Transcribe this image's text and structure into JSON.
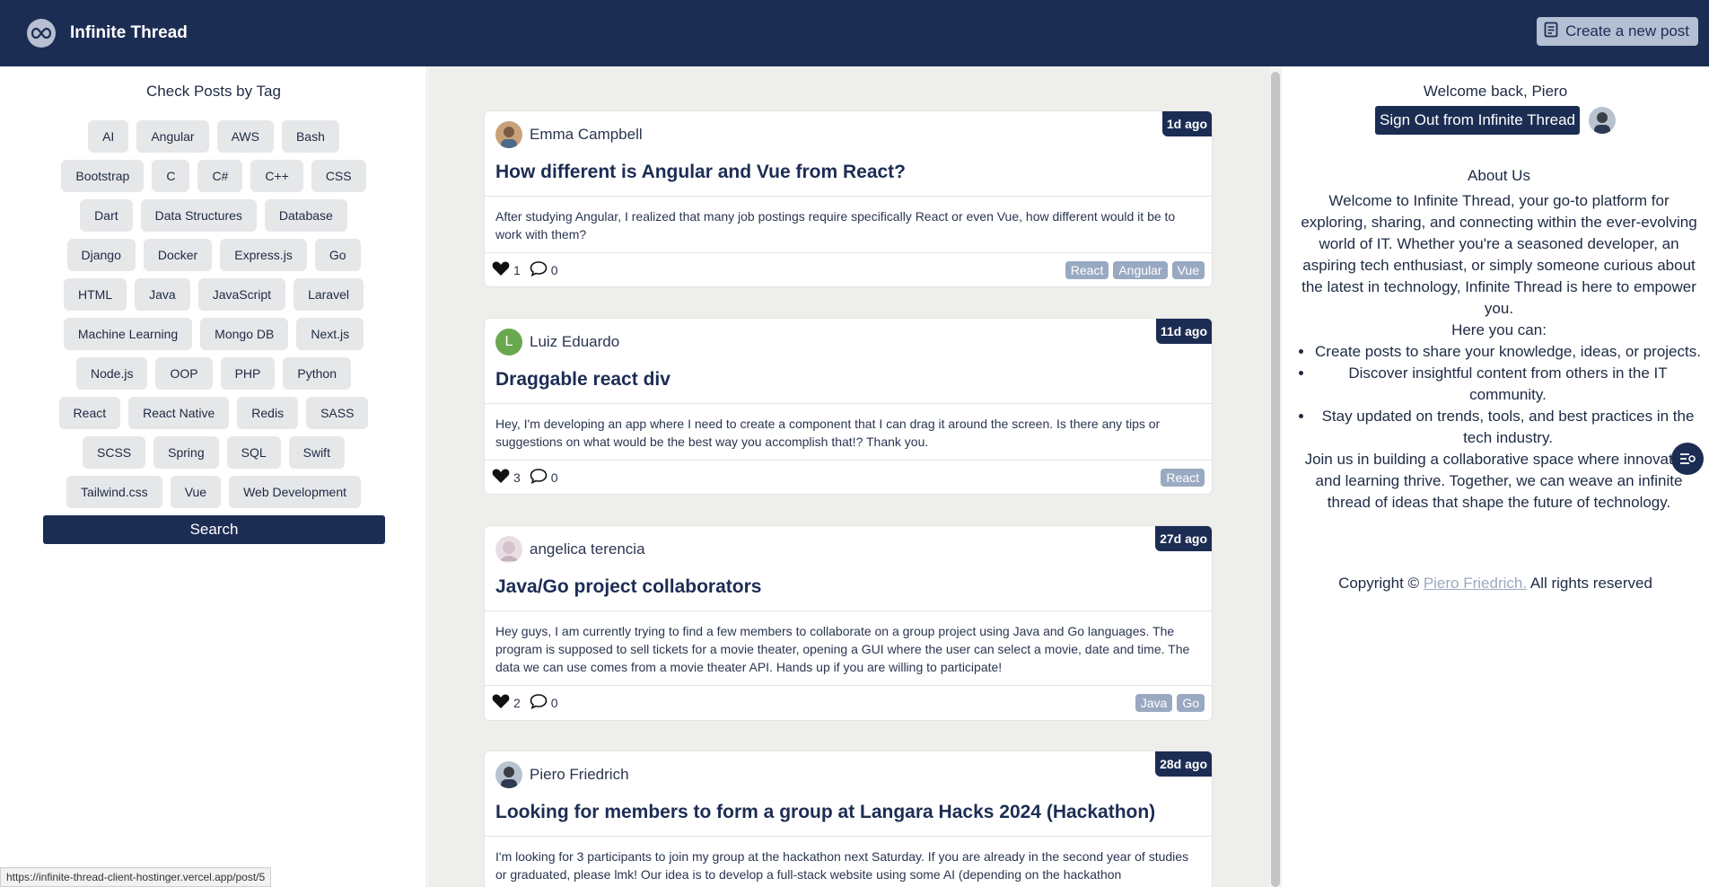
{
  "header": {
    "brand": "Infinite Thread",
    "create_label": "Create a new post"
  },
  "left": {
    "title": "Check Posts by Tag",
    "tags": [
      "AI",
      "Angular",
      "AWS",
      "Bash",
      "Bootstrap",
      "C",
      "C#",
      "C++",
      "CSS",
      "Dart",
      "Data Structures",
      "Database",
      "Django",
      "Docker",
      "Express.js",
      "Go",
      "HTML",
      "Java",
      "JavaScript",
      "Laravel",
      "Machine Learning",
      "Mongo DB",
      "Next.js",
      "Node.js",
      "OOP",
      "PHP",
      "Python",
      "React",
      "React Native",
      "Redis",
      "SASS",
      "SCSS",
      "Spring",
      "SQL",
      "Swift",
      "Tailwind.css",
      "Vue",
      "Web Development"
    ],
    "search_label": "Search"
  },
  "status_url": "https://infinite-thread-client-hostinger.vercel.app/post/5",
  "posts": [
    {
      "author": "Emma Campbell",
      "age": "1d ago",
      "title": "How different is Angular and Vue from React?",
      "body": "After studying Angular, I realized that many job postings require specifically React or even Vue, how different would it be to work with them?",
      "likes": "1",
      "comments": "0",
      "tags": [
        "React",
        "Angular",
        "Vue"
      ]
    },
    {
      "author": "Luiz Eduardo",
      "avatar_letter": "L",
      "age": "11d ago",
      "title": "Draggable react div",
      "body": "Hey, I'm developing an app where I need to create a component that I can drag it around the screen. Is there any tips or suggestions on what would be the best way you accomplish that!? Thank you.",
      "likes": "3",
      "comments": "0",
      "tags": [
        "React"
      ]
    },
    {
      "author": "angelica terencia",
      "age": "27d ago",
      "title": "Java/Go project collaborators",
      "body": "Hey guys, I am currently trying to find a few members to collaborate on a group project using Java and Go languages. The program is supposed to sell tickets for a movie theater, opening a GUI where the user can select a movie, date and time. The data we can use comes from a movie theater API. Hands up if you are willing to participate!",
      "likes": "2",
      "comments": "0",
      "tags": [
        "Java",
        "Go"
      ]
    },
    {
      "author": "Piero Friedrich",
      "age": "28d ago",
      "title": "Looking for members to form a group at Langara Hacks 2024 (Hackathon)",
      "body": "I'm looking for 3 participants to join my group at the hackathon next Saturday. If you are already in the second year of studies or graduated, please lmk! Our idea is to develop a full-stack website using some AI (depending on the hackathon",
      "likes": "",
      "comments": "",
      "tags": []
    }
  ],
  "right": {
    "welcome": "Welcome back, Piero",
    "signout_label": "Sign Out from Infinite Thread",
    "about_title": "About Us",
    "about_intro": "Welcome to Infinite Thread, your go-to platform for exploring, sharing, and connecting within the ever-evolving world of IT. Whether you're a seasoned developer, an aspiring tech enthusiast, or simply someone curious about the latest in technology, Infinite Thread is here to empower you.",
    "about_here": "Here you can:",
    "about_points": [
      "Create posts to share your knowledge, ideas, or projects.",
      "Discover insightful content from others in the IT community.",
      "Stay updated on trends, tools, and best practices in the tech industry."
    ],
    "about_outro": "Join us in building a collaborative space where innovation and learning thrive. Together, we can weave an infinite thread of ideas that shape the future of technology.",
    "copyright_prefix": "Copyright ©",
    "copyright_link": "Piero Friedrich.",
    "copyright_suffix": "All rights reserved"
  },
  "colors": {
    "navy": "#1c2d54",
    "tag_bg": "#e6e7e9",
    "post_tag": "#9aa9c2",
    "feed_bg": "#eeeeea"
  }
}
